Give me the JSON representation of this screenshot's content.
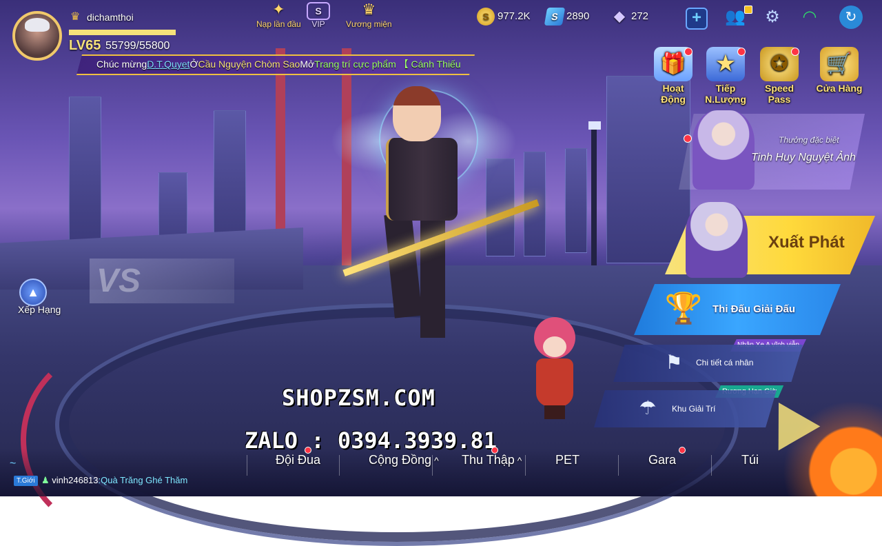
{
  "profile": {
    "username": "dichamthoi",
    "level": "LV65",
    "exp_text": "55799/55800",
    "exp_fraction": 0.99998
  },
  "ticker": {
    "prefix": "Chúc mừng",
    "player": "D.T.Quyet",
    "mid1": "Ở",
    "location": "Cầu Nguyện Chòm Sao",
    "mid2": "Mở",
    "item": "Trang trí cực phẩm 【 Cánh Thiếu"
  },
  "top_center": {
    "first_topup": "Nạp lần đầu",
    "vip": "VIP",
    "vip_badge": "S",
    "crown": "Vương miện"
  },
  "currency": {
    "coins": "977.2K",
    "s_cards": "2890",
    "diamonds": "272"
  },
  "shop_icons": [
    {
      "label": "Hoạt Động",
      "icon": "gift-icon",
      "glyph": "🎁"
    },
    {
      "label": "Tiếp N.Lượng",
      "icon": "star-box-icon",
      "glyph": "★"
    },
    {
      "label": "Speed Pass",
      "icon": "pass-badge-icon",
      "glyph": "✪"
    },
    {
      "label": "Cửa Hàng",
      "icon": "cart-icon",
      "glyph": "🛒"
    }
  ],
  "promo": {
    "subtitle": "Thưởng đặc biệt",
    "title": "Tinh Huy Nguyệt Ảnh"
  },
  "actions": {
    "start": "Xuất Phát",
    "tournament": "Thi Đấu Giải Đấu",
    "personal_tag": "Nhận Xe A vĩnh viễn",
    "personal": "Chi tiết cá nhân",
    "recreation_tag": "Rương Hạn Giờ",
    "recreation": "Khu Giải Trí"
  },
  "left": {
    "ranking": "Xếp Hạng"
  },
  "watermark": {
    "line1": "SHOPZSM.COM",
    "line2": "ZALO : 0394.3939.81"
  },
  "bottom_nav": [
    {
      "label": "Đội Đua"
    },
    {
      "label": "Cộng Đồng"
    },
    {
      "label": "Thu Thập"
    },
    {
      "label": "PET"
    },
    {
      "label": "Gara"
    },
    {
      "label": "Túi"
    }
  ],
  "chat": {
    "channel": "T.Giới",
    "user": "vinh246813",
    "message": ":Quà Trăng Ghé Thăm"
  },
  "colors": {
    "accent_gold": "#f6e27a",
    "accent_blue": "#3aa6ff",
    "notification_red": "#ff3344"
  }
}
